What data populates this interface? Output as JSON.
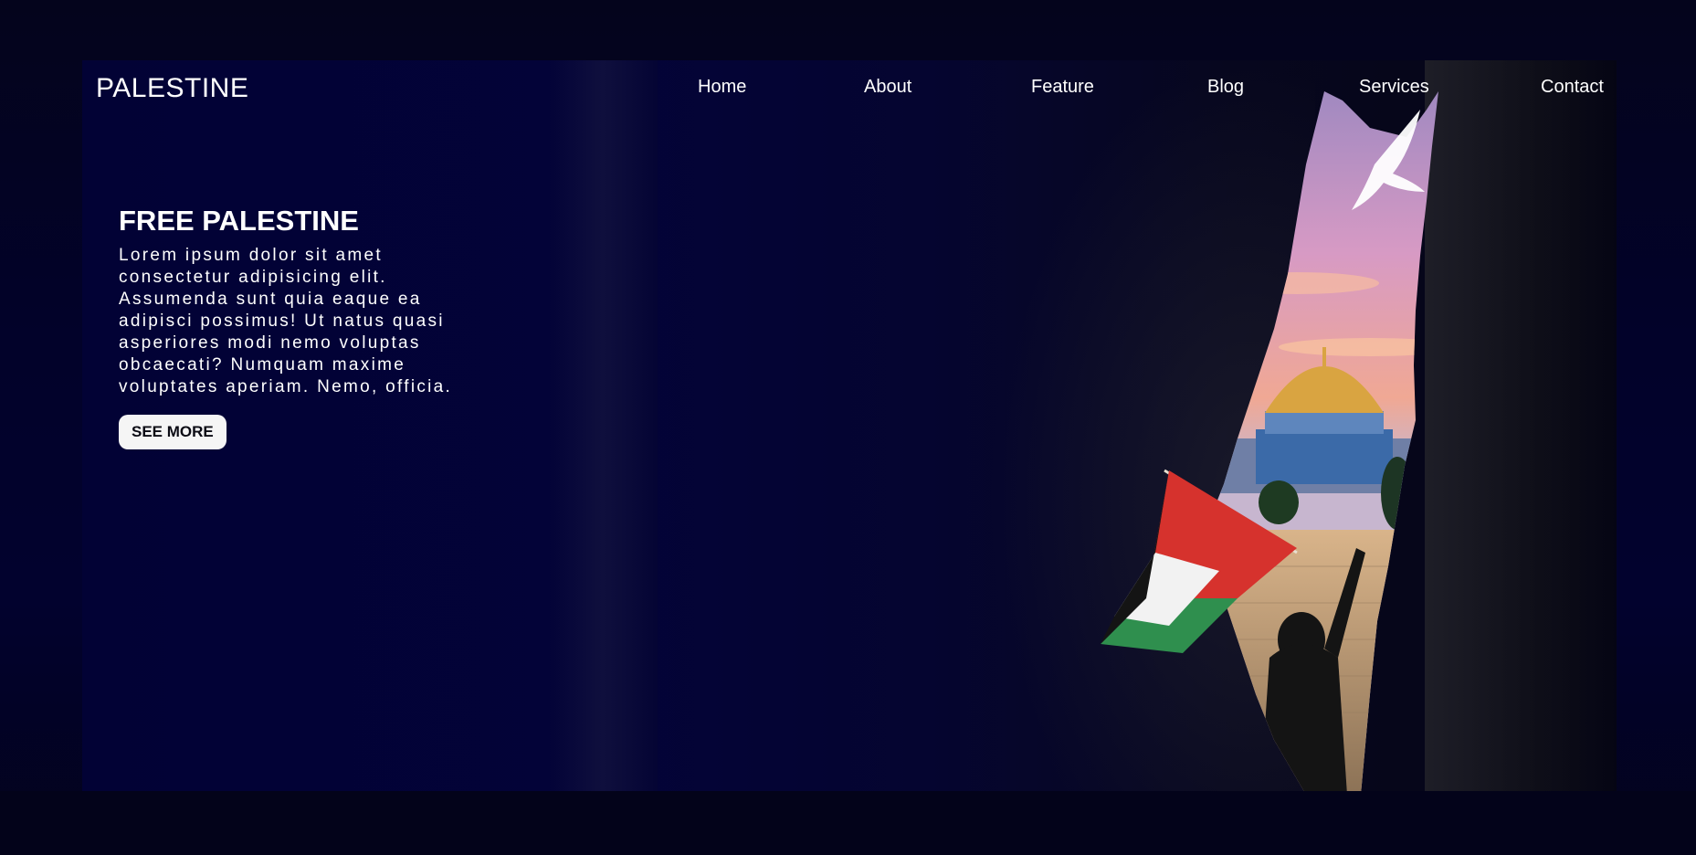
{
  "brand": {
    "logo_text": "PALESTINE"
  },
  "nav": {
    "items": [
      {
        "label": "Home"
      },
      {
        "label": "About"
      },
      {
        "label": "Feature"
      },
      {
        "label": "Blog"
      },
      {
        "label": "Services"
      },
      {
        "label": "Contact"
      }
    ]
  },
  "hero": {
    "title": "FREE PALESTINE",
    "body": "Lorem ipsum dolor sit amet consectetur adipisicing elit. Assumenda sunt quia eaque ea adipisci possimus! Ut natus quasi asperiores modi nemo voluptas obcaecati? Numquam maxime voluptates aperiam. Nemo, officia.",
    "button_label": "SEE MORE"
  },
  "image": {
    "icon": "palestine-map-cave-illustration",
    "colors": {
      "sky_top": "#e8a6c8",
      "sky_bottom": "#f1b49a",
      "dome": "#d9a441",
      "flag_red": "#d6322d",
      "flag_green": "#2f8f4e",
      "flag_black": "#141414",
      "flag_white": "#f2f2f2"
    }
  }
}
